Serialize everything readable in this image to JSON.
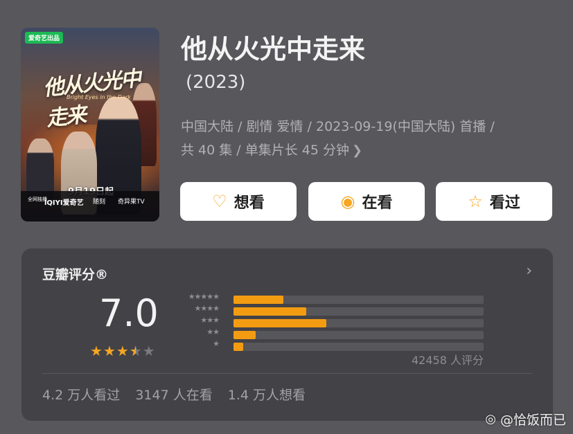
{
  "poster": {
    "badge": "爱奇艺出品",
    "title_art": "他从火光中走来",
    "subtitle_art": "Bright Eyes in the Dark",
    "release_date": "9月19日起",
    "platform_note": "全网独播",
    "logos": [
      "iQIYI爱奇艺",
      "随刻",
      "奇异果TV"
    ]
  },
  "title": "他从火光中走来",
  "year": "(2023)",
  "info": {
    "line1": "中国大陆 / 剧情 爱情 / 2023-09-19(中国大陆) 首播 /",
    "line2": "共 40 集 / 单集片长 45 分钟"
  },
  "actions": {
    "want": "想看",
    "watching": "在看",
    "watched": "看过"
  },
  "rating": {
    "label": "豆瓣评分®",
    "score": "7.0",
    "stars": 3.5,
    "count": "42458 人评分",
    "distribution": [
      {
        "stars": 5,
        "fraction": 0.2
      },
      {
        "stars": 4,
        "fraction": 0.29
      },
      {
        "stars": 3,
        "fraction": 0.37
      },
      {
        "stars": 2,
        "fraction": 0.09
      },
      {
        "stars": 1,
        "fraction": 0.04
      }
    ],
    "stats": {
      "watched": "4.2 万人看过",
      "watching": "3147 人在看",
      "want": "1.4 万人想看"
    }
  },
  "watermark": "@恰饭而已",
  "colors": {
    "accent": "#f5a623",
    "bar": "#f39c12",
    "background": "#58575b",
    "card": "#434247"
  }
}
